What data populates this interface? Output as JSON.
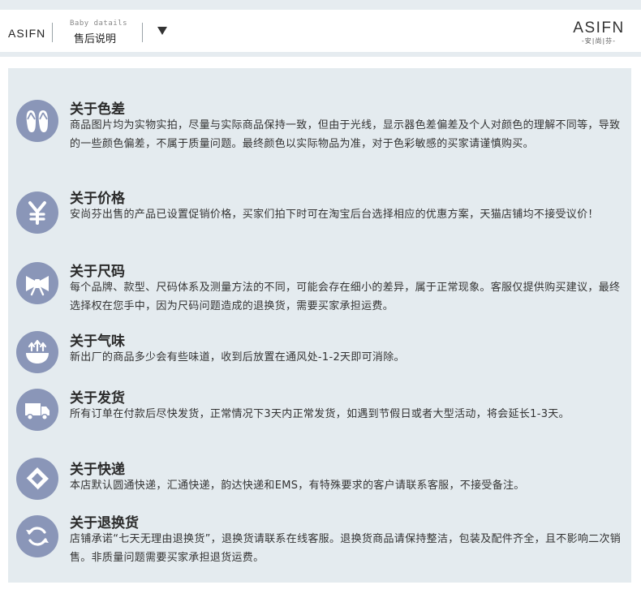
{
  "header": {
    "brand": "ASIFN",
    "subtitle_en": "Baby datails",
    "subtitle_cn": "售后说明",
    "logo_main": "ASIFN",
    "logo_sub": "-安|尚|芬-"
  },
  "items": [
    {
      "icon": "flip-flops-icon",
      "title": "关于色差",
      "text": "商品图片均为实物实拍，尽量与实际商品保持一致，但由于光线，显示器色差偏差及个人对颜色的理解不同等，导致的一些颜色偏差，不属于质量问题。最终颜色以实际物品为准，对于色彩敏感的买家请谨慎购买。"
    },
    {
      "icon": "yen-icon",
      "title": "关于价格",
      "text": "安尚芬出售的产品已设置促销价格，买家们拍下时可在淘宝后台选择相应的优惠方案，天猫店铺均不接受议价！"
    },
    {
      "icon": "bow-tie-icon",
      "title": "关于尺码",
      "text": "每个品牌、款型、尺码体系及测量方法的不同，可能会存在细小的差异，属于正常现象。客服仅提供购买建议，最终选择权在您手中，因为尺码问题造成的退换货，需要买家承担运费。"
    },
    {
      "icon": "steam-bowl-icon",
      "title": "关于气味",
      "text": "新出厂的商品多少会有些味道，收到后放置在通风处-1-2天即可消除。"
    },
    {
      "icon": "delivery-truck-icon",
      "title": "关于发货",
      "text": "所有订单在付款后尽快发货，正常情况下3天内正常发货，如遇到节假日或者大型活动，将会延长1-3天。"
    },
    {
      "icon": "express-logo-icon",
      "title": "关于快递",
      "text": "本店默认圆通快递，汇通快递，韵达快递和EMS，有特殊要求的客户请联系客服，不接受备注。"
    },
    {
      "icon": "return-arrows-icon",
      "title": "关于退换货",
      "text": "店铺承诺“七天无理由退换货”，退换货请联系在线客服。退换货商品请保持整洁，包装及配件齐全，且不影响二次销售。非质量问题需要买家承担退货运费。"
    }
  ]
}
